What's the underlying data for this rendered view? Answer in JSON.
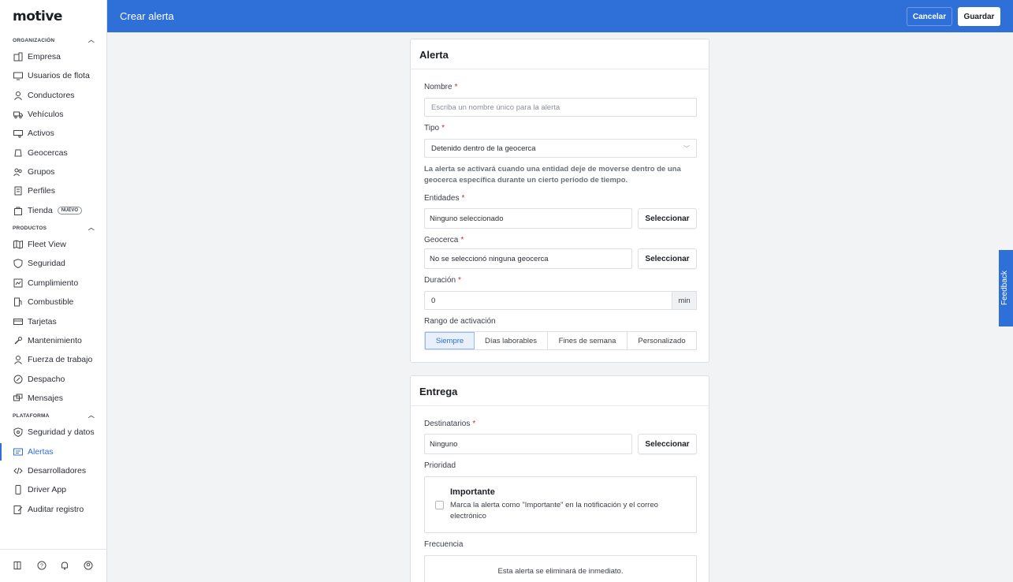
{
  "brand": {
    "logo": "motive"
  },
  "sidebar": {
    "sections": [
      {
        "label": "ORGANIZACIÓN"
      },
      {
        "label": "PRODUCTOS"
      },
      {
        "label": "PLATAFORMA"
      }
    ],
    "items": [
      {
        "label": "Empresa",
        "icon": "building-icon"
      },
      {
        "label": "Usuarios de flota",
        "icon": "monitor-icon"
      },
      {
        "label": "Conductores",
        "icon": "person-icon"
      },
      {
        "label": "Vehículos",
        "icon": "truck-icon"
      },
      {
        "label": "Activos",
        "icon": "trailer-icon"
      },
      {
        "label": "Geocercas",
        "icon": "geofence-icon"
      },
      {
        "label": "Grupos",
        "icon": "group-icon"
      },
      {
        "label": "Perfiles",
        "icon": "profiles-icon"
      },
      {
        "label": "Tienda",
        "icon": "shopping-bag-icon",
        "badge": "NUEVO"
      },
      {
        "label": "Fleet View",
        "icon": "map-icon"
      },
      {
        "label": "Seguridad",
        "icon": "shield-icon"
      },
      {
        "label": "Cumplimiento",
        "icon": "compliance-icon"
      },
      {
        "label": "Combustible",
        "icon": "fuel-icon"
      },
      {
        "label": "Tarjetas",
        "icon": "card-icon"
      },
      {
        "label": "Mantenimiento",
        "icon": "wrench-icon"
      },
      {
        "label": "Fuerza de trabajo",
        "icon": "worker-icon"
      },
      {
        "label": "Despacho",
        "icon": "dispatch-icon"
      },
      {
        "label": "Mensajes",
        "icon": "messages-icon"
      },
      {
        "label": "Seguridad y datos",
        "icon": "shield-lock-icon"
      },
      {
        "label": "Alertas",
        "icon": "alert-icon"
      },
      {
        "label": "Desarrolladores",
        "icon": "code-icon"
      },
      {
        "label": "Driver App",
        "icon": "phone-icon"
      },
      {
        "label": "Auditar registro",
        "icon": "audit-icon"
      }
    ],
    "active_item": "Alertas"
  },
  "header": {
    "title": "Crear alerta",
    "cancel": "Cancelar",
    "save": "Guardar"
  },
  "alert_card": {
    "title": "Alerta",
    "name_label": "Nombre",
    "name_placeholder": "Escriba un nombre único para la alerta",
    "type_label": "Tipo",
    "type_value": "Detenido dentro de la geocerca",
    "type_help": "La alerta se activará cuando una entidad deje de moverse dentro de una geocerca específica durante un cierto período de tiempo.",
    "entities_label": "Entidades",
    "entities_value": "Ninguno seleccionado",
    "geofence_label": "Geocerca",
    "geofence_value": "No se seleccionó ninguna geocerca",
    "select_button": "Seleccionar",
    "duration_label": "Duración",
    "duration_value": "0",
    "duration_unit": "min",
    "range_label": "Rango de activación",
    "range_options": [
      "Siempre",
      "Días laborables",
      "Fines de semana",
      "Personalizado"
    ],
    "range_selected": "Siempre"
  },
  "delivery_card": {
    "title": "Entrega",
    "recipients_label": "Destinatarios",
    "recipients_value": "Ninguno",
    "select_button": "Seleccionar",
    "priority_label": "Prioridad",
    "important_title": "Importante",
    "important_desc": "Marca la alerta como \"Importante\" en la notificación y el correo electrónico",
    "important_checked": false,
    "frequency_label": "Frecuencia",
    "frequency_text": "Esta alerta se eliminará de inmediato."
  },
  "feedback": {
    "label": "Feedback"
  },
  "required_mark": "*",
  "colors": {
    "accent": "#2f6fd8"
  }
}
